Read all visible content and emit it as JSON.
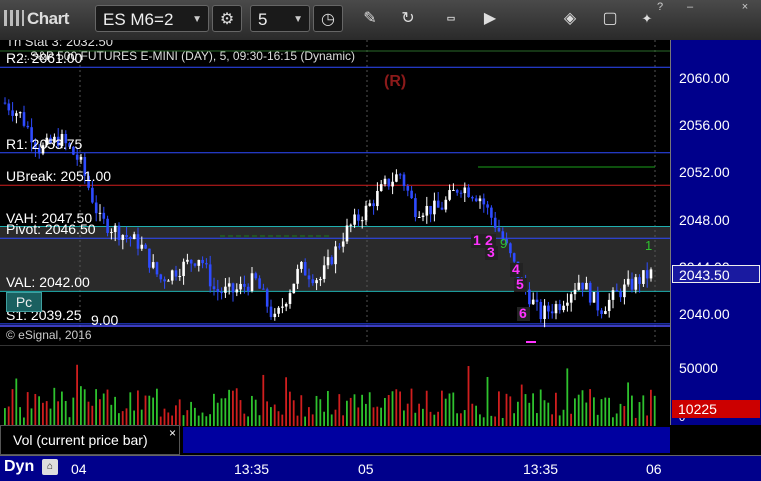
{
  "toolbar": {
    "app_title": "Chart",
    "symbol_value": "ES M6=2",
    "interval_value": "5",
    "icons": [
      "gear-icon",
      "clock-icon",
      "pencil-icon",
      "refresh-icon",
      "get-icon",
      "play-icon",
      "tag-icon",
      "comment-icon",
      "twitter-icon"
    ]
  },
  "window": {
    "help": "?",
    "minimize": "–",
    "close": "×"
  },
  "chart": {
    "header_partial": "Th Stat 3: 2032.50",
    "title": "...S&P 500 FUTURES E-MINI (DAY), 5, 09:30-16:15 (Dynamic)",
    "watermark": "(R)",
    "copyright": "© eSignal, 2016",
    "levels": [
      {
        "label": "R2: 2061.00",
        "price": 2061.0,
        "color": "#2e4bff"
      },
      {
        "label": "R1: 2053.75",
        "price": 2053.75,
        "color": "#2e4bff"
      },
      {
        "label": "UBreak: 2051.00",
        "price": 2051.0,
        "color": "#d01e1e"
      },
      {
        "label": "VAH: 2047.50",
        "price": 2047.5,
        "color": "#20b0b0"
      },
      {
        "label": "Pivot: 2046.50",
        "price": 2046.5,
        "color": "#2e4bff"
      },
      {
        "label": "VAL: 2042.00",
        "price": 2042.0,
        "color": "#20b0b0"
      },
      {
        "label": "S1: 2039.25",
        "price": 2039.25,
        "color": "#2e4bff"
      }
    ],
    "extra_level_label": "9.00",
    "pc_badge": "Pc",
    "y_ticks": [
      "2060.00",
      "2056.00",
      "2052.00",
      "2048.00",
      "2044.00",
      "2040.00"
    ],
    "last_price": "2043.50",
    "x_labels": [
      "04",
      "13:35",
      "05",
      "13:35",
      "06"
    ],
    "sequence_marks": [
      "1",
      "2",
      "3",
      "4",
      "5",
      "6"
    ],
    "green_marks": [
      "9",
      "1"
    ]
  },
  "volume": {
    "y_ticks": [
      "50000",
      "0"
    ],
    "last_value": "10225",
    "study_label": "Vol (current price bar)",
    "close_label": "×"
  },
  "bottom": {
    "dyn_label": "Dyn"
  },
  "colors": {
    "up_bar": "#ffffff",
    "down_bar": "#2e4bff",
    "axis_bg": "#00008b",
    "vol_up": "#2ec22e",
    "vol_down": "#d01e1e",
    "magenta": "#ff33ff"
  }
}
